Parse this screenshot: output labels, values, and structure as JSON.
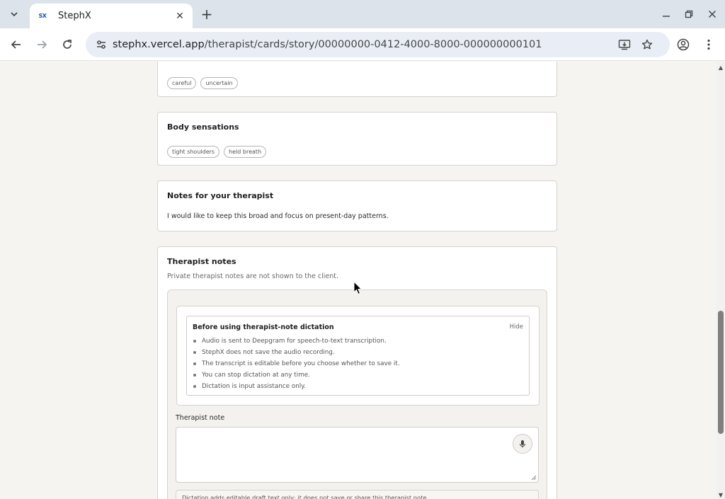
{
  "browser": {
    "tab_title": "StephX",
    "favicon_text": "SX",
    "url_host": "stephx.vercel.app",
    "url_path": "/therapist/cards/story/00000000-0412-4000-8000-000000000101"
  },
  "cards": {
    "emotions": {
      "chips": [
        "careful",
        "uncertain"
      ]
    },
    "body": {
      "title": "Body sensations",
      "chips": [
        "tight shoulders",
        "held breath"
      ]
    },
    "client_notes": {
      "title": "Notes for your therapist",
      "text": "I would like to keep this broad and focus on present-day patterns."
    },
    "therapist": {
      "title": "Therapist notes",
      "subtitle": "Private therapist notes are not shown to the client.",
      "disclosure": {
        "title": "Before using therapist-note dictation",
        "hide_label": "Hide",
        "items": [
          "Audio is sent to Deepgram for speech-to-text transcription.",
          "StephX does not save the audio recording.",
          "The transcript is editable before you choose whether to save it.",
          "You can stop dictation at any time.",
          "Dictation is input assistance only."
        ]
      },
      "field_label": "Therapist note",
      "field_value": "",
      "hint": "Dictation adds editable draft text only; it does not save or share this therapist note."
    }
  },
  "colors": {
    "page_bg": "#f5f4f1",
    "card_border": "#d6d3cd",
    "accent": "#0b57d0"
  }
}
